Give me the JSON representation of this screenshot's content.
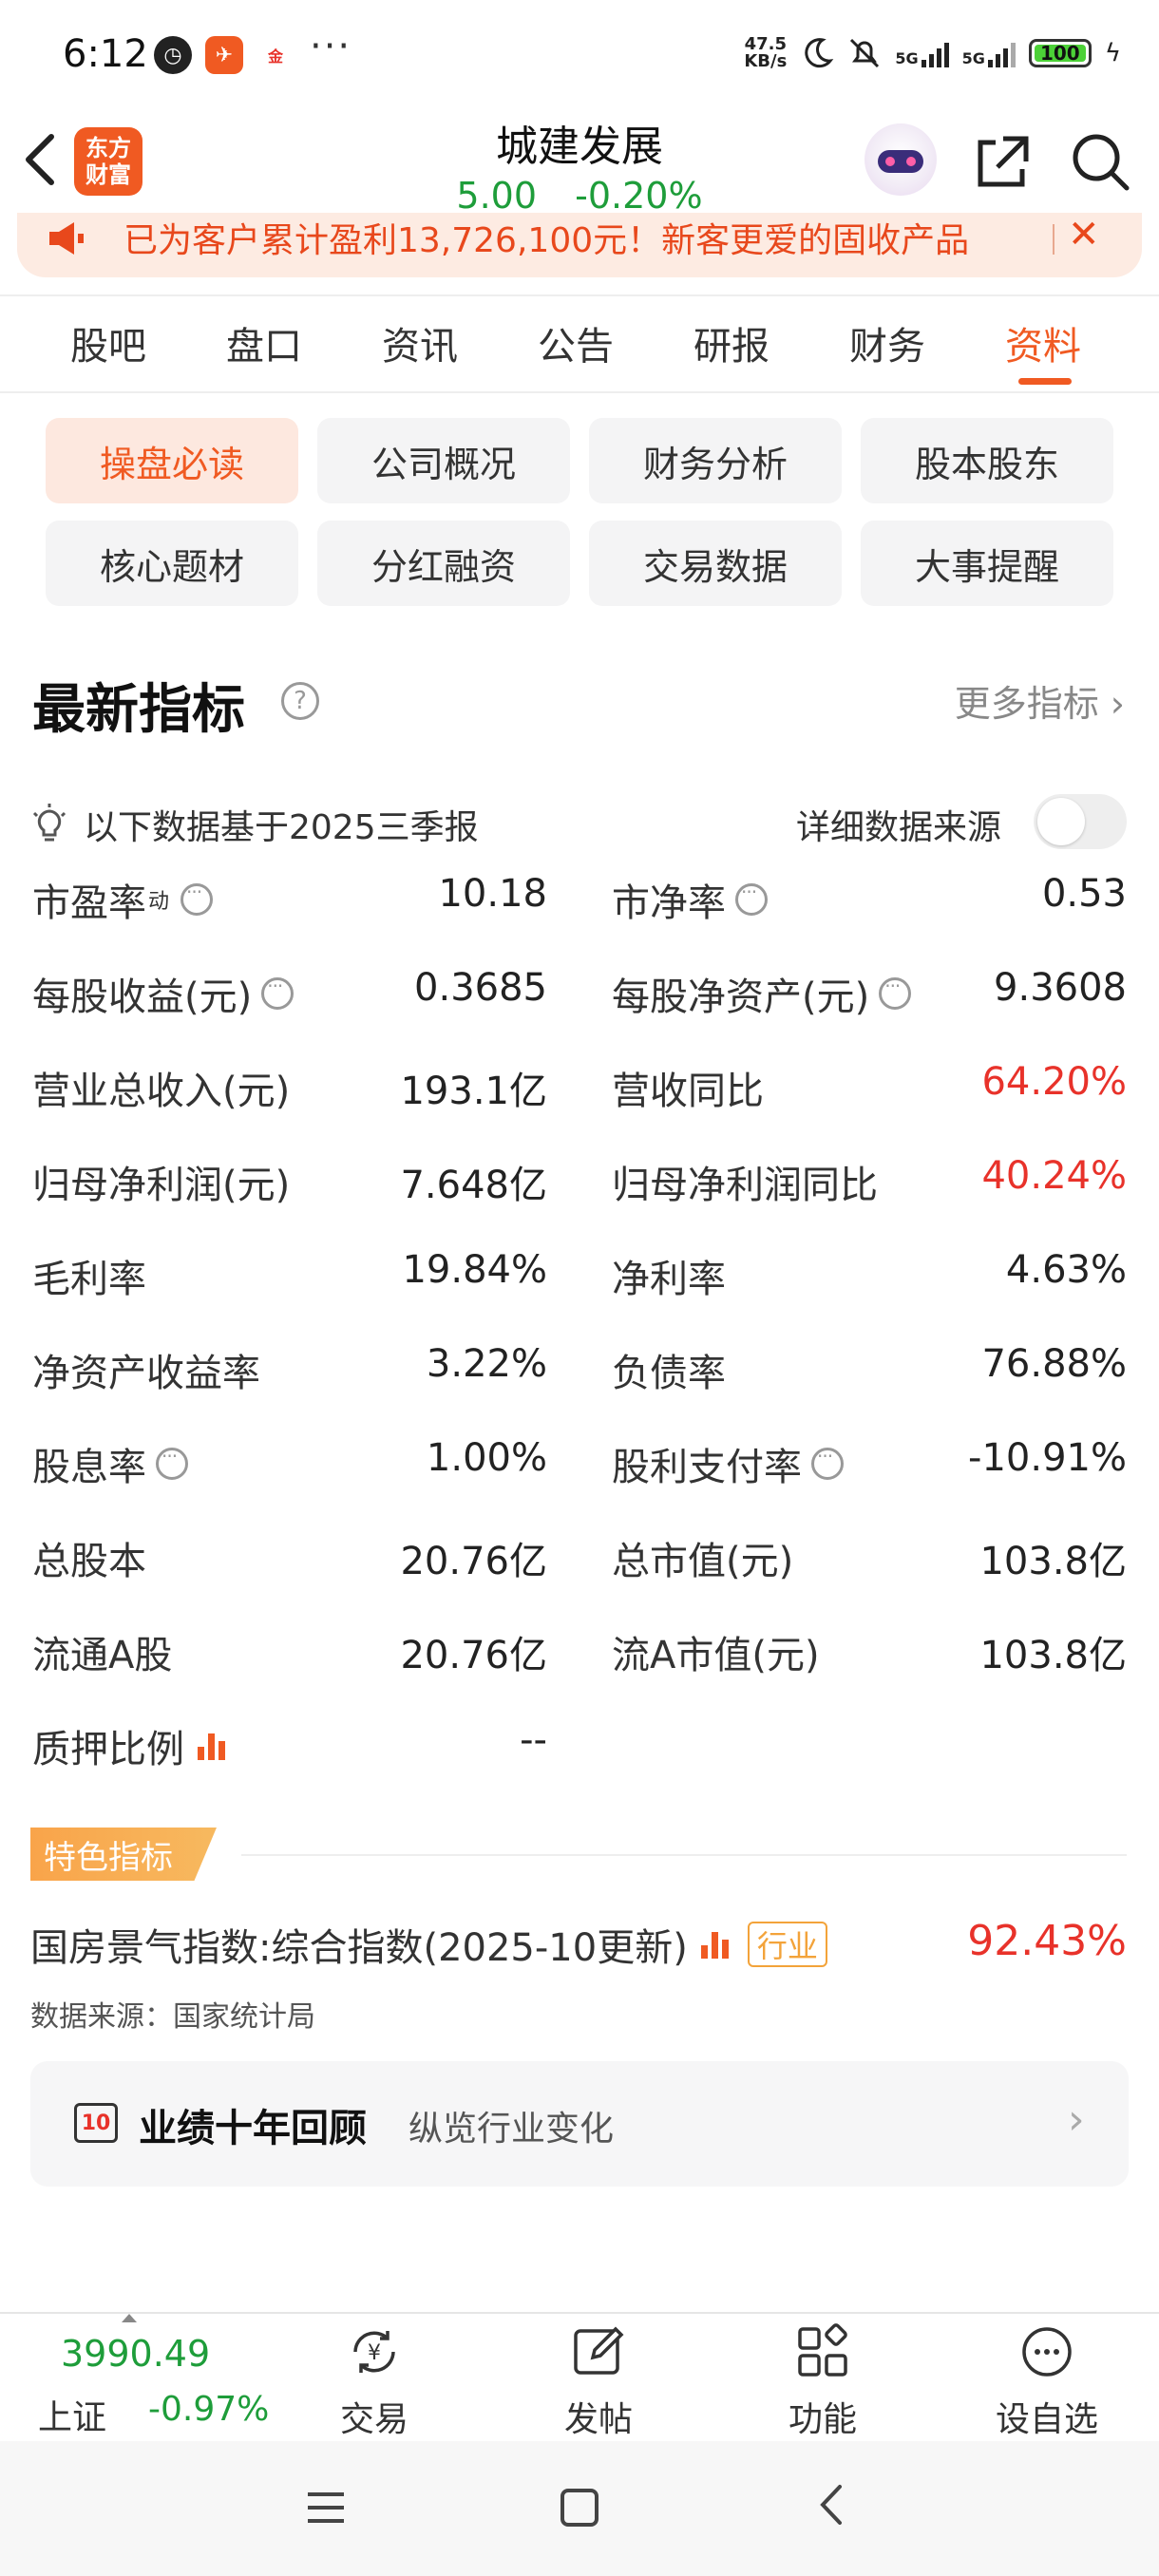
{
  "status_bar": {
    "time": "6:12",
    "net_speed": "47.5\nKB/s",
    "battery": "100",
    "signal_1": "5G",
    "signal_2": "5G"
  },
  "header": {
    "logo_text": "东方\n财富",
    "stock_name": "城建发展",
    "price": "5.00",
    "change": "-0.20%"
  },
  "banner": {
    "text": "已为客户累计盈利13,726,100元！新客更爱的固收产品"
  },
  "tabs": [
    {
      "label": "股吧"
    },
    {
      "label": "盘口"
    },
    {
      "label": "资讯"
    },
    {
      "label": "公告"
    },
    {
      "label": "研报"
    },
    {
      "label": "财务"
    },
    {
      "label": "资料"
    }
  ],
  "grid_buttons": [
    {
      "label": "操盘必读"
    },
    {
      "label": "公司概况"
    },
    {
      "label": "财务分析"
    },
    {
      "label": "股本股东"
    },
    {
      "label": "核心题材"
    },
    {
      "label": "分红融资"
    },
    {
      "label": "交易数据"
    },
    {
      "label": "大事提醒"
    }
  ],
  "section": {
    "title": "最新指标",
    "help": "?",
    "more": "更多指标 ›",
    "note": "以下数据基于2025三季报",
    "source_toggle_label": "详细数据来源"
  },
  "metrics": [
    {
      "l_label": "市盈率",
      "l_sup": "动",
      "l_value": "10.18",
      "r_label": "市净率",
      "r_value": "0.53"
    },
    {
      "l_label": "每股收益(元)",
      "l_value": "0.3685",
      "r_label": "每股净资产(元)",
      "r_value": "9.3608"
    },
    {
      "l_label": "营业总收入(元)",
      "l_value": "193.1亿",
      "r_label": "营收同比",
      "r_value": "64.20%"
    },
    {
      "l_label": "归母净利润(元)",
      "l_value": "7.648亿",
      "r_label": "归母净利润同比",
      "r_value": "40.24%"
    },
    {
      "l_label": "毛利率",
      "l_value": "19.84%",
      "r_label": "净利率",
      "r_value": "4.63%"
    },
    {
      "l_label": "净资产收益率",
      "l_value": "3.22%",
      "r_label": "负债率",
      "r_value": "76.88%"
    },
    {
      "l_label": "股息率",
      "l_value": "1.00%",
      "r_label": "股利支付率",
      "r_value": "-10.91%"
    },
    {
      "l_label": "总股本",
      "l_value": "20.76亿",
      "r_label": "总市值(元)",
      "r_value": "103.8亿"
    },
    {
      "l_label": "流通A股",
      "l_value": "20.76亿",
      "r_label": "流A市值(元)",
      "r_value": "103.8亿"
    },
    {
      "l_label": "质押比例",
      "l_value": "--"
    }
  ],
  "special": {
    "tag": "特色指标",
    "housing_label": "国房景气指数:综合指数(2025-10更新)",
    "industry_tag": "行业",
    "housing_value": "92.43%",
    "data_source": "数据来源：国家统计局"
  },
  "review": {
    "icon_text": "10",
    "title": "业绩十年回顾",
    "subtitle": "纵览行业变化",
    "arrow": "›"
  },
  "bottom_bar": {
    "index_value": "3990.49",
    "index_name": "上证",
    "index_change": "-0.97%",
    "items": [
      {
        "label": "交易"
      },
      {
        "label": "发帖"
      },
      {
        "label": "功能"
      },
      {
        "label": "设自选"
      }
    ]
  },
  "colors": {
    "accent": "#f05a22",
    "up_red": "#e8322a",
    "down_green": "#1e9d3a"
  }
}
